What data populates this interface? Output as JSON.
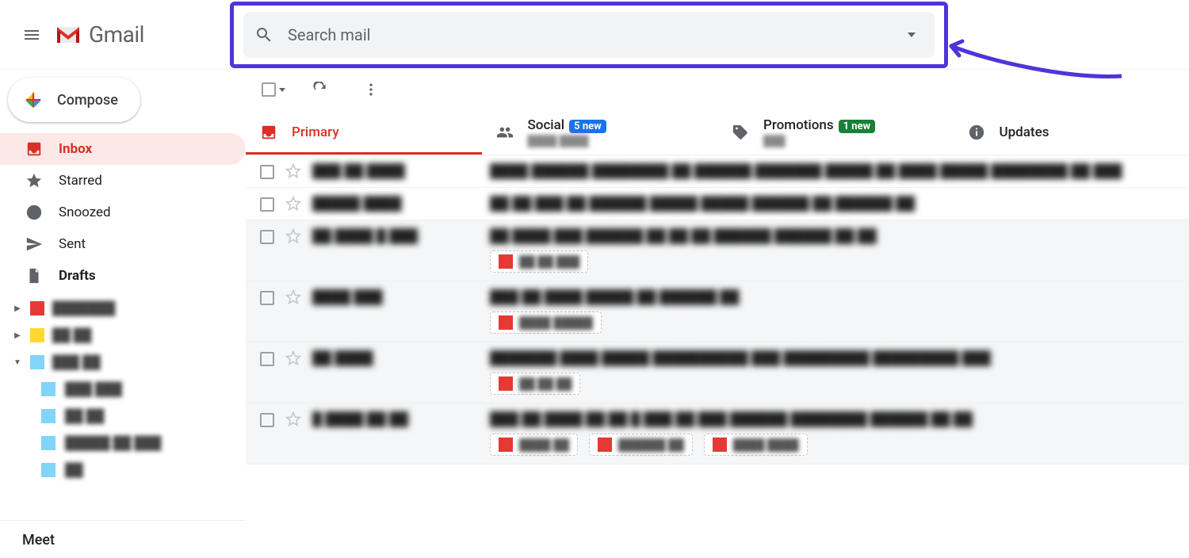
{
  "app_name": "Gmail",
  "search": {
    "placeholder": "Search mail"
  },
  "compose_label": "Compose",
  "sidebar": {
    "items": [
      {
        "label": "Inbox",
        "active": true
      },
      {
        "label": "Starred"
      },
      {
        "label": "Snoozed"
      },
      {
        "label": "Sent"
      },
      {
        "label": "Drafts",
        "bold": true
      }
    ],
    "labels": [
      {
        "text": "███████",
        "color": "red-box",
        "expandable": true
      },
      {
        "text": "██ ██",
        "color": "yellow-box",
        "expandable": true
      },
      {
        "text": "███ ██",
        "color": "cyan-box",
        "expandable": true,
        "expanded": true
      }
    ],
    "sublabels": [
      {
        "text": "███ ███"
      },
      {
        "text": "██ ██"
      },
      {
        "text": "█████ ██ ███"
      },
      {
        "text": "██"
      }
    ],
    "meet_label": "Meet"
  },
  "tabs": [
    {
      "title": "Primary",
      "active": true
    },
    {
      "title": "Social",
      "badge": "5 new",
      "badge_color": "blue",
      "secondary": "████ ████"
    },
    {
      "title": "Promotions",
      "badge": "1 new",
      "badge_color": "green",
      "secondary": "███"
    },
    {
      "title": "Updates"
    }
  ],
  "mail_rows": [
    {
      "state": "unread",
      "sender": "███ ██ ████",
      "subject": "████ ██████ ████████ ██ ██████ ███████ █████ ██ ████ █████ ████████   ██ ███"
    },
    {
      "state": "unread",
      "sender": "█████ ████",
      "subject": "██ ██ ███  ██ ██████ █████ █████ ██████ ██ ██████ ██"
    },
    {
      "state": "read",
      "sender": "██  ████  █ ███",
      "subject": "██ ████ ███ ██████ ██ ██ ██ ██████ ██████ ██ ██",
      "attachments": [
        "██ ██ ███"
      ]
    },
    {
      "state": "read",
      "sender": "████ ███",
      "subject": "███  ██ ████ █████ ██ ██████ ██",
      "attachments": [
        "████ █████"
      ]
    },
    {
      "state": "read",
      "sender": "██ ████",
      "subject": "███████ ████ █████ ██████████ ███ █████████  █████████ ███",
      "attachments": [
        "██ ██ ██"
      ]
    },
    {
      "state": "read",
      "sender": "█   ████ ██ ██",
      "subject": "███ ██ ████ ██ ██ █  ███ ██ ███ ██████  ████████ ██████ ██ ██",
      "attachments": [
        "████ ██",
        "██████ ██",
        "████  ████"
      ]
    }
  ]
}
